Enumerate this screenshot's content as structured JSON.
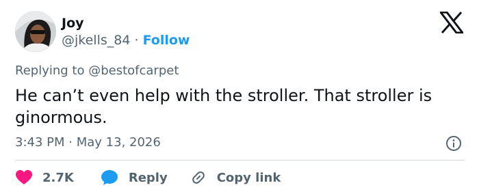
{
  "tweet": {
    "author_name": "Joy",
    "handle": "@jkells_84",
    "separator": "·",
    "follow_label": "Follow",
    "replying_prefix": "Replying to",
    "replying_to": "@bestofcarpet",
    "text": "He can’t even help with the stroller. That stroller is ginormous.",
    "time": "3:43 PM",
    "date": "May 13, 2026"
  },
  "actions": {
    "like_count": "2.7K",
    "reply_label": "Reply",
    "copy_link_label": "Copy link"
  },
  "icons": {
    "brand": "x-logo-icon",
    "info": "info-icon",
    "like": "heart-icon",
    "reply": "speech-bubble-icon",
    "copy": "link-icon"
  },
  "colors": {
    "text": "#0f1419",
    "muted": "#536471",
    "accent": "#1d9bf0",
    "like": "#f91880",
    "divider": "#cfd9de"
  }
}
